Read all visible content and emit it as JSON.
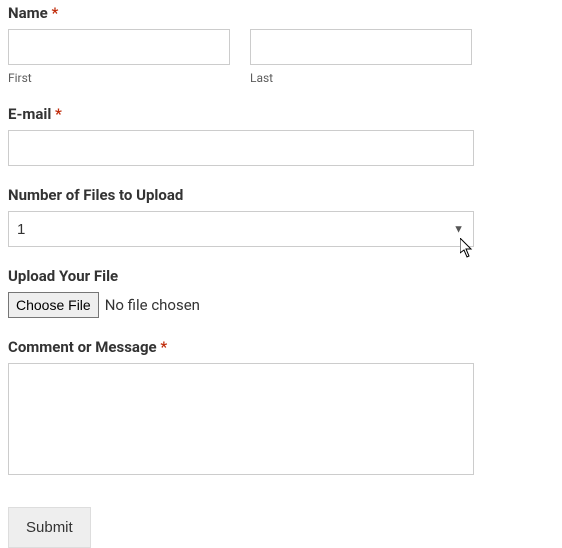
{
  "form": {
    "name": {
      "label": "Name",
      "required": "*",
      "first_sub": "First",
      "last_sub": "Last",
      "first_value": "",
      "last_value": ""
    },
    "email": {
      "label": "E-mail",
      "required": "*",
      "value": ""
    },
    "num_files": {
      "label": "Number of Files to Upload",
      "selected": "1"
    },
    "upload": {
      "label": "Upload Your File",
      "button": "Choose File",
      "status": "No file chosen"
    },
    "comment": {
      "label": "Comment or Message",
      "required": "*",
      "value": ""
    },
    "submit": {
      "label": "Submit"
    }
  }
}
